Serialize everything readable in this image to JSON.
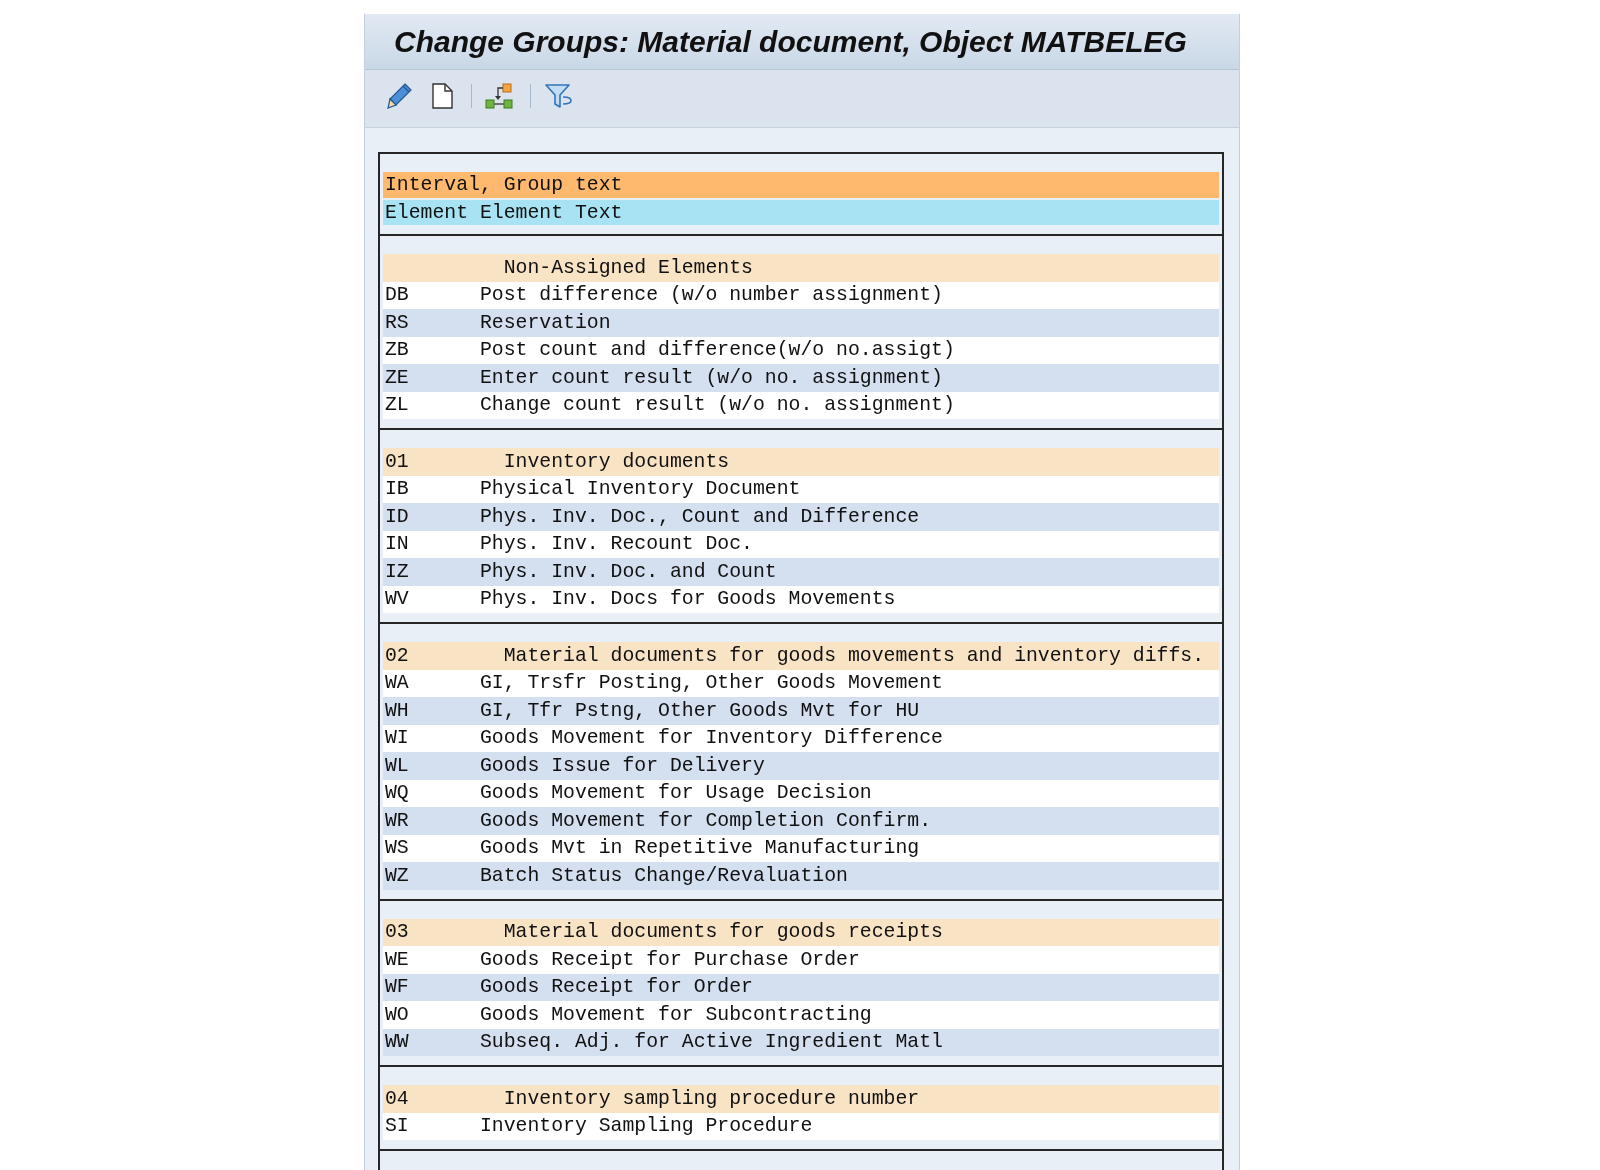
{
  "window": {
    "title": "Change Groups: Material document, Object MATBELEG"
  },
  "legend": [
    {
      "kind": "group",
      "text": "Interval, Group text"
    },
    {
      "kind": "element",
      "text": "Element Element Text"
    }
  ],
  "groups": [
    {
      "group_text": "Non-Assigned Elements",
      "elements": [
        {
          "element": "DB",
          "text": "Post difference (w/o number assignment)"
        },
        {
          "element": "RS",
          "text": "Reservation"
        },
        {
          "element": "ZB",
          "text": "Post count and difference(w/o no.assigt)"
        },
        {
          "element": "ZE",
          "text": "Enter count result (w/o no. assignment)"
        },
        {
          "element": "ZL",
          "text": "Change count result (w/o no. assignment)"
        }
      ]
    },
    {
      "interval": "01",
      "group_text": "Inventory documents",
      "elements": [
        {
          "element": "IB",
          "text": "Physical Inventory Document"
        },
        {
          "element": "ID",
          "text": "Phys. Inv. Doc., Count and Difference"
        },
        {
          "element": "IN",
          "text": "Phys. Inv. Recount Doc."
        },
        {
          "element": "IZ",
          "text": "Phys. Inv. Doc. and Count"
        },
        {
          "element": "WV",
          "text": "Phys. Inv. Docs for Goods Movements"
        }
      ]
    },
    {
      "interval": "02",
      "group_text": "Material documents for goods movements and inventory diffs.",
      "elements": [
        {
          "element": "WA",
          "text": "GI, Trsfr Posting, Other Goods Movement"
        },
        {
          "element": "WH",
          "text": "GI, Tfr Pstng, Other Goods Mvt for HU"
        },
        {
          "element": "WI",
          "text": "Goods Movement for Inventory Difference"
        },
        {
          "element": "WL",
          "text": "Goods Issue for Delivery"
        },
        {
          "element": "WQ",
          "text": "Goods Movement for Usage Decision"
        },
        {
          "element": "WR",
          "text": "Goods Movement for Completion Confirm."
        },
        {
          "element": "WS",
          "text": "Goods Mvt in Repetitive Manufacturing"
        },
        {
          "element": "WZ",
          "text": "Batch Status Change/Revaluation"
        }
      ]
    },
    {
      "interval": "03",
      "group_text": "Material documents for goods receipts",
      "elements": [
        {
          "element": "WE",
          "text": "Goods Receipt for Purchase Order"
        },
        {
          "element": "WF",
          "text": "Goods Receipt for Order"
        },
        {
          "element": "WO",
          "text": "Goods Movement for Subcontracting"
        },
        {
          "element": "WW",
          "text": "Subseq. Adj. for Active Ingredient Matl"
        }
      ]
    },
    {
      "interval": "04",
      "group_text": "Inventory sampling procedure number",
      "elements": [
        {
          "element": "SI",
          "text": "Inventory Sampling Procedure"
        }
      ]
    }
  ]
}
